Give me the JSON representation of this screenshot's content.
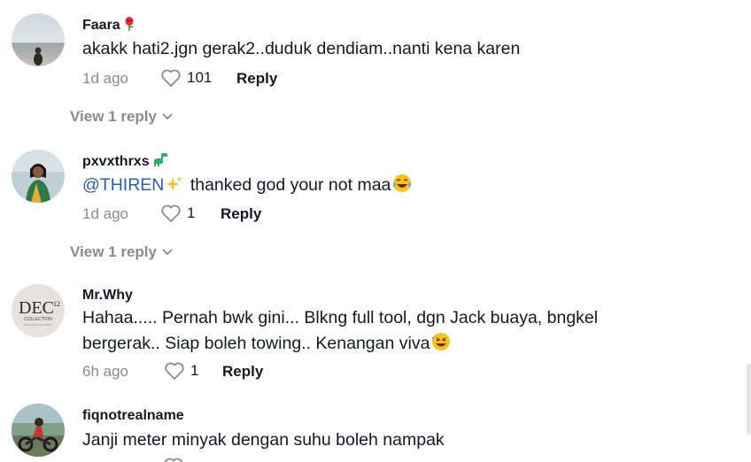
{
  "comments": [
    {
      "username": "Faara",
      "badge": "rose-emoji",
      "text": "akakk hati2.jgn gerak2..duduk dendiam..nanti kena karen",
      "time": "1d ago",
      "likes": "101",
      "reply_label": "Reply",
      "view_replies": "View 1 reply"
    },
    {
      "username": "pxvxthrxs",
      "badge": "dinosaur-emoji",
      "mention": "@THIREN",
      "text_after": "thanked god your not maa",
      "time": "1d ago",
      "likes": "1",
      "reply_label": "Reply",
      "view_replies": "View 1 reply"
    },
    {
      "username": "Mr.Why",
      "avatar_text": "DEC",
      "avatar_num": "12",
      "avatar_sub": "COLLECTION",
      "text": "Hahaa..... Pernah bwk gini... Blkng full tool, dgn Jack buaya, bngkel bergerak.. Siap boleh towing.. Kenangan viva",
      "time": "6h ago",
      "likes": "1",
      "reply_label": "Reply"
    },
    {
      "username": "fiqnotrealname",
      "text": "Janji meter minyak dengan suhu boleh nampak"
    }
  ],
  "colors": {
    "text": "#161823",
    "muted": "#8a8b91",
    "mention": "#2b5db9"
  }
}
